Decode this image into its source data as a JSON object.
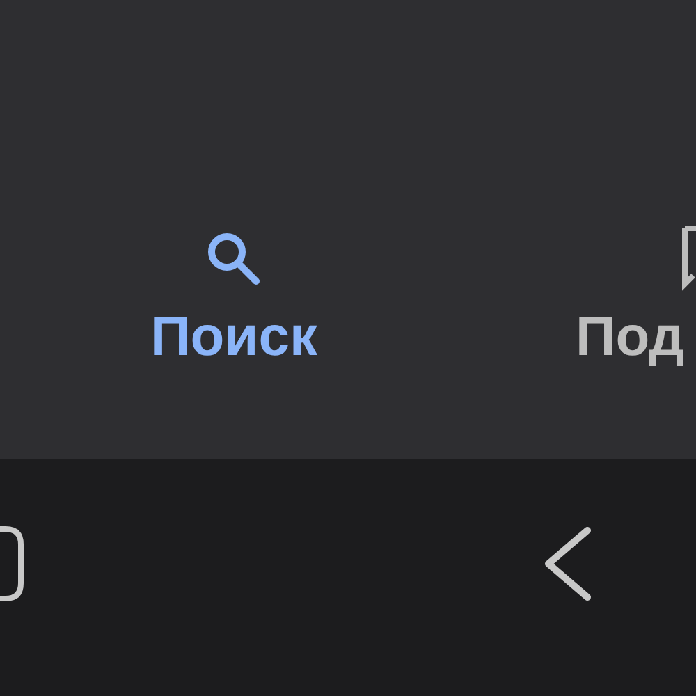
{
  "tabs": [
    {
      "label": "Поиск",
      "kind": "search",
      "selected": true
    },
    {
      "label": "Под",
      "kind": "message",
      "selected": false
    }
  ]
}
